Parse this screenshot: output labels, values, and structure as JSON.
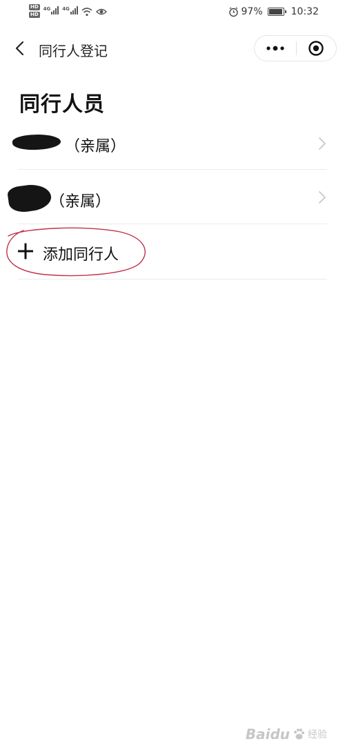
{
  "status_bar": {
    "hd_top": "HD",
    "hd_bottom": "HD",
    "net1": "4G",
    "net2": "4G",
    "battery_percent": "97%",
    "battery_level": 0.97,
    "time": "10:32",
    "icons": [
      "wifi-icon",
      "eye-icon",
      "alarm-icon",
      "battery-icon"
    ]
  },
  "nav": {
    "title": "同行人登记",
    "back_icon": "chevron-left-icon",
    "more_icon": "more-dots-icon",
    "close_icon": "target-close-icon"
  },
  "section": {
    "title": "同行人员"
  },
  "companions": [
    {
      "relation": "（亲属）"
    },
    {
      "relation": "（亲属）"
    }
  ],
  "add": {
    "label": "添加同行人",
    "icon": "plus-icon"
  },
  "watermark": {
    "brand": "Baidu",
    "sub": "经验"
  },
  "colors": {
    "annotation_circle": "#c0304a",
    "divider": "#ececec",
    "redaction": "#151515"
  }
}
